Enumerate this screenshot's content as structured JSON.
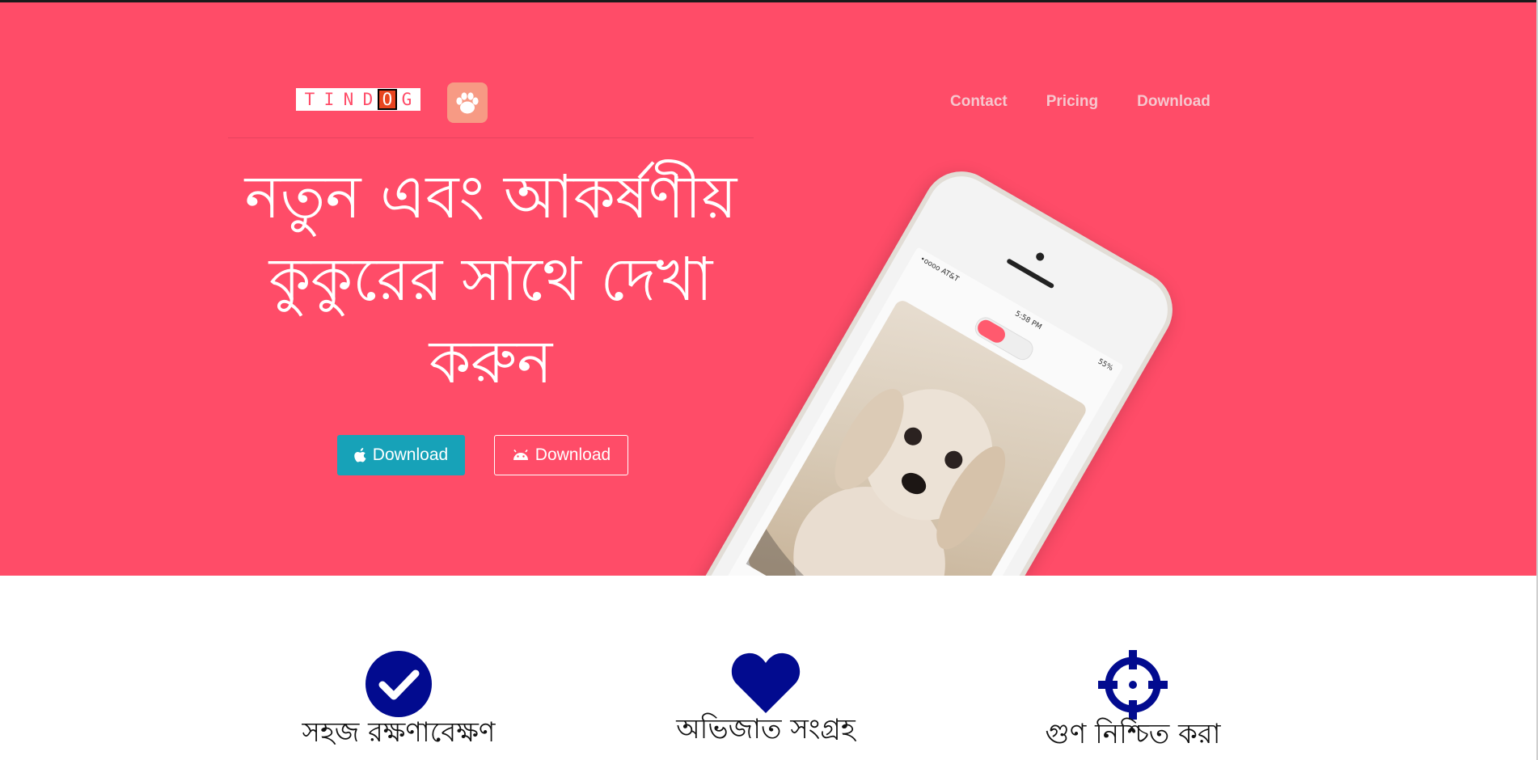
{
  "brand": {
    "letters": [
      "T",
      "I",
      "N",
      "D",
      "O",
      "G"
    ],
    "highlight_index": 4,
    "accent": "#ff4c68"
  },
  "nav": {
    "links": [
      "Contact",
      "Pricing",
      "Download"
    ]
  },
  "hero": {
    "headline_lines": [
      "নতুন এবং আকর্ষণীয়",
      "কুকুরের সাথে দেখা",
      "করুন"
    ],
    "background": "#ff4c68",
    "buttons": [
      {
        "label": "Download",
        "icon": "apple-icon"
      },
      {
        "label": "Download",
        "icon": "android-icon"
      }
    ],
    "phone": {
      "carrier": "•oooo AT&T",
      "time": "5:58 PM",
      "battery": "55%"
    }
  },
  "features": [
    {
      "title": "সহজ রক্ষণাবেক্ষণ",
      "icon": "check-circle-icon",
      "color": "#020b8f"
    },
    {
      "title": "অভিজাত সংগ্রহ",
      "icon": "heart-icon",
      "color": "#020b8f"
    },
    {
      "title": "গুণ নিশ্চিত করা",
      "icon": "crosshairs-icon",
      "color": "#020b8f"
    }
  ]
}
